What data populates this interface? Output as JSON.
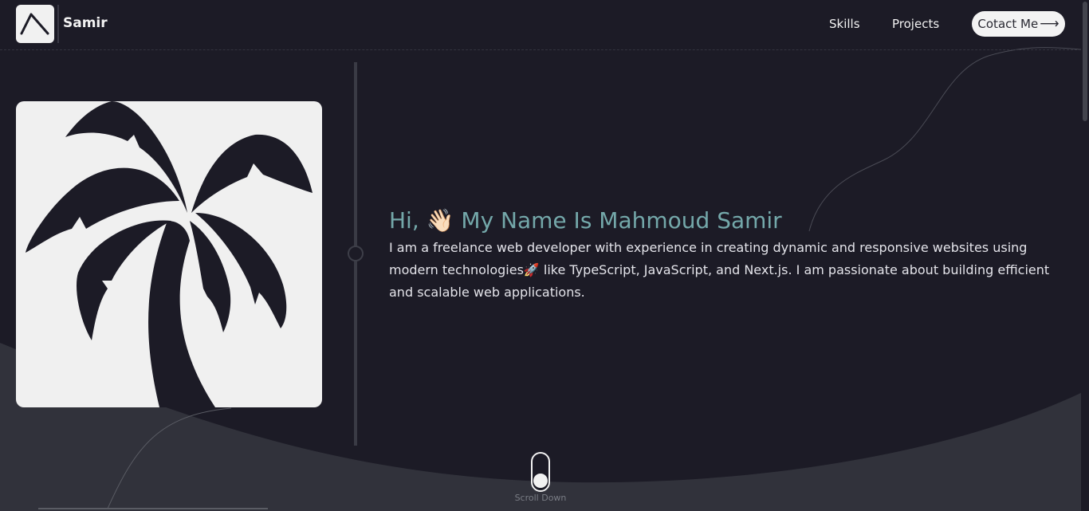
{
  "header": {
    "brand": "Samir",
    "nav": {
      "skills": "Skills",
      "projects": "Projects"
    },
    "contact_label": "Cotact Me",
    "contact_icon": "arrow-right-icon"
  },
  "hero": {
    "greeting": "Hi,",
    "greeting_emoji": "👋🏻",
    "title": "My Name Is Mahmoud Samir",
    "desc_part1": "I am a freelance web developer with experience in creating dynamic and responsive websites using modern technologies",
    "desc_emoji": "🚀",
    "desc_part2": " like TypeScript, JavaScript, and Next.js. I am passionate about building efficient and scalable web applications."
  },
  "scroll": {
    "label": "Scroll Down"
  },
  "colors": {
    "background": "#1c1b26",
    "wave": "#31323b",
    "accent": "#74a8aa",
    "card": "#f0f0f0"
  },
  "icons": {
    "logo": "logo-chevron-icon",
    "avatar": "palm-tree-icon",
    "scroll": "mouse-scroll-icon"
  }
}
